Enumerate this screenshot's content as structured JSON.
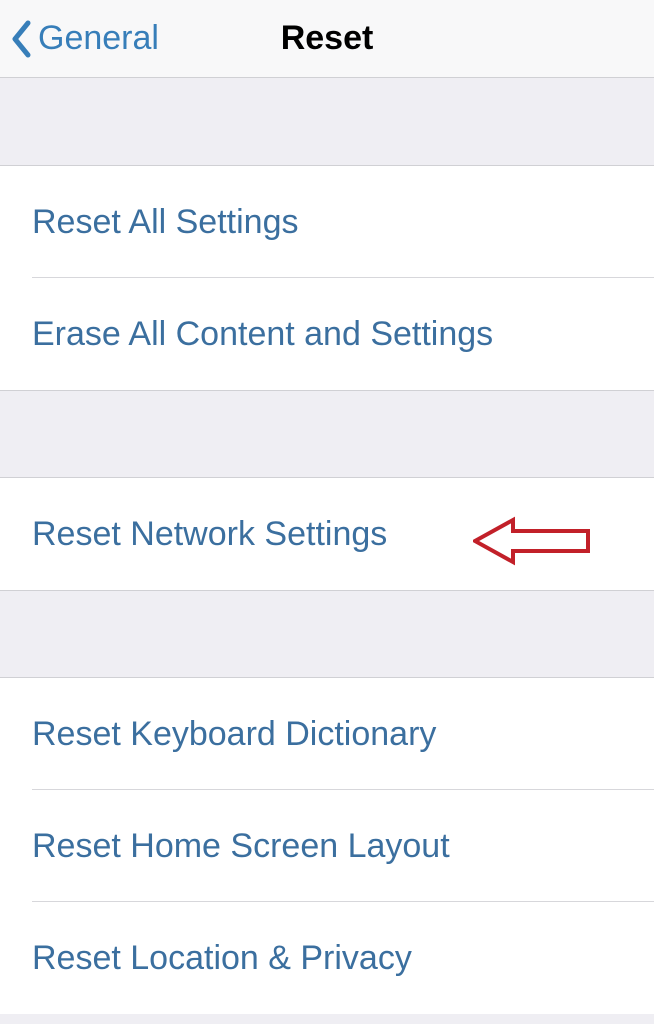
{
  "header": {
    "back_label": "General",
    "title": "Reset"
  },
  "groups": [
    {
      "items": [
        {
          "label": "Reset All Settings"
        },
        {
          "label": "Erase All Content and Settings"
        }
      ]
    },
    {
      "items": [
        {
          "label": "Reset Network Settings",
          "highlighted": true
        }
      ]
    },
    {
      "items": [
        {
          "label": "Reset Keyboard Dictionary"
        },
        {
          "label": "Reset Home Screen Layout"
        },
        {
          "label": "Reset Location & Privacy"
        }
      ]
    }
  ],
  "annotation": {
    "arrow_color": "#c22029"
  }
}
